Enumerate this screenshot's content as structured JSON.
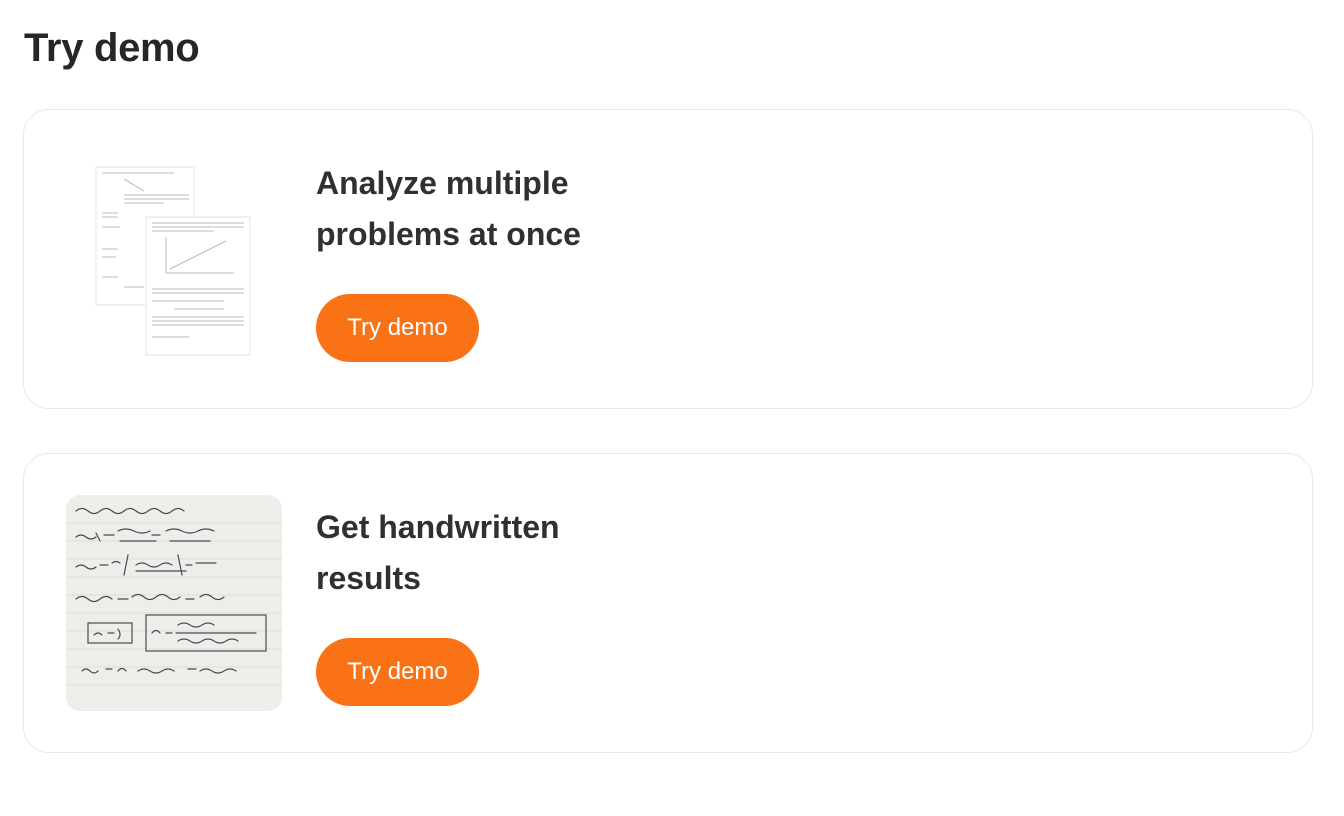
{
  "header": {
    "title": "Try demo"
  },
  "cards": [
    {
      "title_line1": "Analyze multiple",
      "title_line2": "problems at once",
      "button_label": "Try demo"
    },
    {
      "title_line1": "Get handwritten",
      "title_line2": "results",
      "button_label": "Try demo"
    }
  ],
  "colors": {
    "accent": "#f97316",
    "card_border": "#e9e9e9",
    "text": "#303030"
  }
}
